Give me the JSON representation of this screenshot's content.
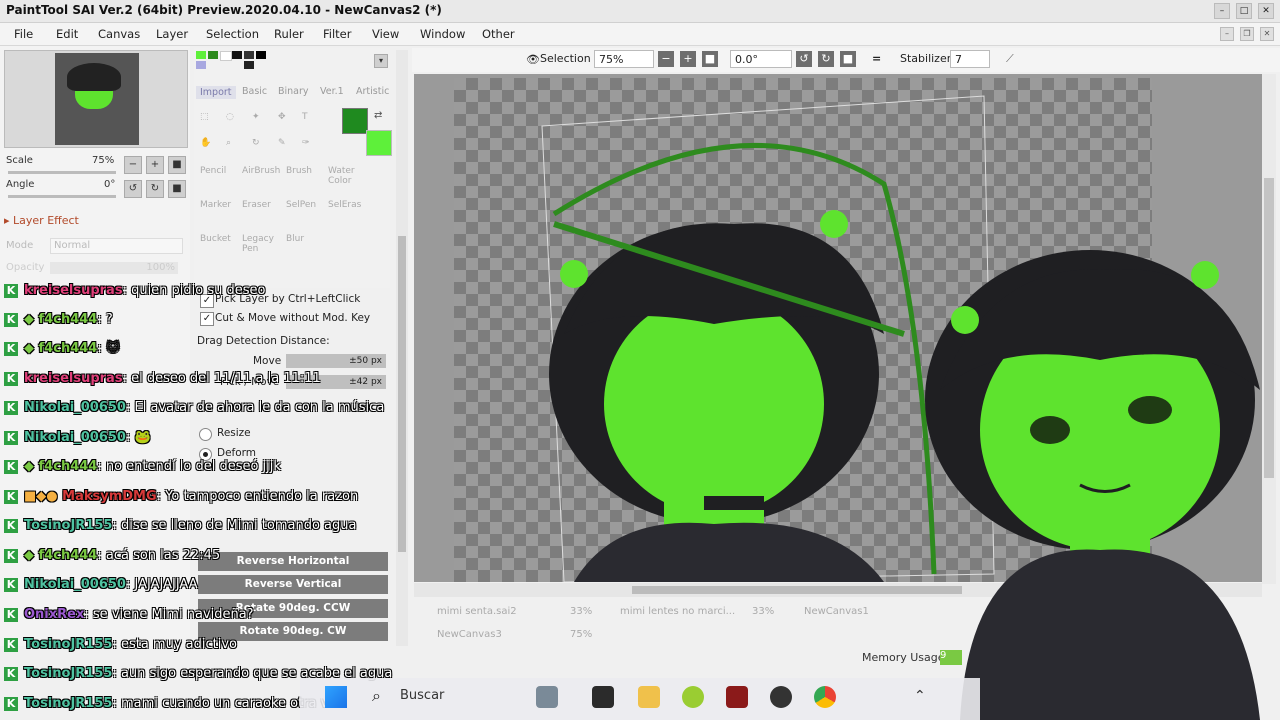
{
  "window": {
    "title": "PaintTool SAI Ver.2 (64bit) Preview.2020.04.10 - NewCanvas2 (*)"
  },
  "menu": [
    "File",
    "Edit",
    "Canvas",
    "Layer",
    "Selection",
    "Ruler",
    "Filter",
    "View",
    "Window",
    "Other"
  ],
  "navigator": {
    "scale_label": "Scale",
    "scale_value": "75%",
    "angle_label": "Angle",
    "angle_value": "0°",
    "layer_effect": "Layer Effect",
    "mode_label": "Mode",
    "mode_value": "Normal",
    "opacity_label": "Opacity",
    "opacity_value": "100%"
  },
  "palette": {
    "tabs": [
      "Import",
      "Basic",
      "Binary",
      "Ver.1",
      "Artistic"
    ],
    "tools": [
      "Pencil",
      "AirBrush",
      "Brush",
      "Water Color",
      "Marker",
      "Eraser",
      "SelPen",
      "SelEras",
      "Bucket",
      "Legacy Pen",
      "Blur"
    ],
    "primary_color": "#1f8a1f",
    "secondary_color": "#5ef03a"
  },
  "options": {
    "pick_layer": "Pick Layer by Ctrl+LeftClick",
    "cut_move": "Cut & Move without Mod. Key",
    "drag_label": "Drag Detection Distance:",
    "move_label": "Move",
    "move_value": "±50 px",
    "pick_label": "Pick / Move",
    "pick_value": "±42 px",
    "resize": "Resize",
    "deform": "Deform",
    "btn_reverse_h": "Reverse Horizontal",
    "btn_reverse_v": "Reverse Vertical",
    "btn_rotate_ccw": "Rotate 90deg. CCW",
    "btn_rotate_cw": "Rotate 90deg. CW"
  },
  "toolbar": {
    "selection_label": "Selection",
    "zoom": "75%",
    "angle": "0.0°",
    "stabilizer_label": "Stabilizer",
    "stabilizer_value": "7"
  },
  "files": [
    "mimi senta.sai2",
    "33%",
    "mimi lentes no marci...",
    "33%",
    "NewCanvas1",
    "NewCanvas3",
    "75%"
  ],
  "status": {
    "memory_label": "Memory Usage",
    "memory_value": "9"
  },
  "chat": [
    {
      "user": "kreiselsupras",
      "msg": ": quien pidio su deseo",
      "color": "#e0407a"
    },
    {
      "user": "f4ch444",
      "msg": ": ?",
      "color": "#7ac943"
    },
    {
      "user": "f4ch444",
      "msg": ":",
      "color": "#7ac943"
    },
    {
      "user": "kreiselsupras",
      "msg": ": el deseo del 11/11 a la 11:11",
      "color": "#e0407a"
    },
    {
      "user": "Nikolai_00650",
      "msg": ": El avatar de ahora le da con la música",
      "color": "#4fc3a1"
    },
    {
      "user": "Nikolai_00650",
      "msg": ":",
      "color": "#4fc3a1"
    },
    {
      "user": "f4ch444",
      "msg": ": no entendí lo del deseó jjjk",
      "color": "#7ac943"
    },
    {
      "user": "MaksymDMG",
      "msg": ": Yo tampoco entiendo la razon",
      "color": "#d83a3a"
    },
    {
      "user": "TosinoJR155",
      "msg": ": dise se lleno de Mimi tomando agua",
      "color": "#4fc3a1"
    },
    {
      "user": "f4ch444",
      "msg": ": acá son las 22:45",
      "color": "#7ac943"
    },
    {
      "user": "Nikolai_00650",
      "msg": ": JAJAJAJJAA",
      "color": "#4fc3a1"
    },
    {
      "user": "OnixRex",
      "msg": ": se viene Mimi navideña?",
      "color": "#9b59d0"
    },
    {
      "user": "TosinoJR155",
      "msg": ": esta muy adictivo",
      "color": "#4fc3a1"
    },
    {
      "user": "TosinoJR155",
      "msg": ": aun sigo esperando que se acabe el agua",
      "color": "#4fc3a1"
    },
    {
      "user": "TosinoJR155",
      "msg": ": mami cuando un caraoke otra vez",
      "color": "#4fc3a1"
    }
  ],
  "taskbar": {
    "search": "Buscar"
  },
  "colors": {
    "accent_green": "#5ee32e",
    "dark_green": "#2e8b1e",
    "hair": "#1f1f22"
  }
}
